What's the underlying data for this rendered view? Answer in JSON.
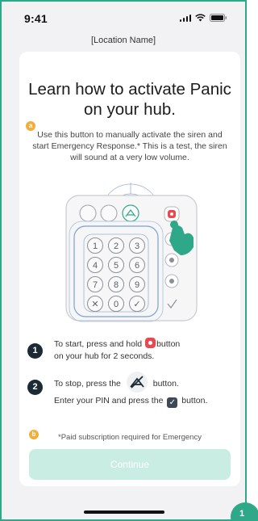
{
  "status_bar": {
    "time": "9:41"
  },
  "header": {
    "location": "[Location Name]"
  },
  "content": {
    "title": "Learn how to activate Panic on your hub.",
    "badge_a": "a",
    "description": "Use this button to manually activate the siren and start Emergency Response.* This is a test, the siren will sound at a very low volume.",
    "hub_keys": [
      "1",
      "2",
      "3",
      "4",
      "5",
      "6",
      "7",
      "8",
      "9",
      "✕",
      "0",
      "✓"
    ],
    "steps": [
      {
        "number": "1",
        "text_before": "To start, press and hold",
        "text_after": "button",
        "line2": "on your hub for 2 seconds."
      },
      {
        "number": "2",
        "text_before": "To stop, press the",
        "text_after": "button.",
        "line2_before": "Enter your PIN and press the",
        "line2_after": "button."
      }
    ],
    "badge_b": "b",
    "footnote": "*Paid subscription required for Emergency",
    "continue_label": "Continue"
  },
  "colors": {
    "accent": "#2fa88a",
    "panic_red": "#e8484f",
    "step_circle": "#1b2a35",
    "badge": "#f2ae3d",
    "button_disabled": "#c9ede3"
  },
  "icons": [
    "signal-icon",
    "wifi-icon",
    "battery-icon",
    "panic-button-icon",
    "disarm-icon",
    "check-icon",
    "hand-pointer-icon"
  ],
  "corner_badge": "1"
}
